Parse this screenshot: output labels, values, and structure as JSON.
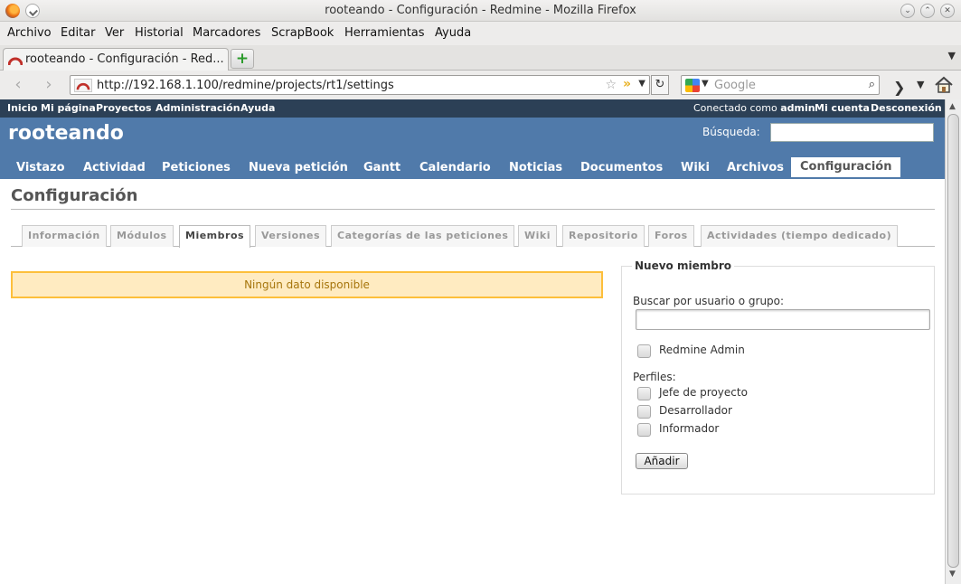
{
  "window": {
    "title": "rooteando - Configuración - Redmine - Mozilla Firefox"
  },
  "menubar": [
    "Archivo",
    "Editar",
    "Ver",
    "Historial",
    "Marcadores",
    "ScrapBook",
    "Herramientas",
    "Ayuda"
  ],
  "browser_tab": {
    "title": "rooteando - Configuración - Red..."
  },
  "navbar": {
    "url": "http://192.168.1.100/redmine/projects/rt1/settings",
    "search_placeholder": "Google"
  },
  "redmine": {
    "top_menu": [
      "Inicio",
      "Mi página",
      "Proyectos",
      "Administración",
      "Ayuda"
    ],
    "logged_as_prefix": "Conectado como",
    "logged_user": "admin",
    "account_links": [
      "Mi cuenta",
      "Desconexión"
    ],
    "project_name": "rooteando",
    "search_label": "Búsqueda:",
    "main_menu": [
      "Vistazo",
      "Actividad",
      "Peticiones",
      "Nueva petición",
      "Gantt",
      "Calendario",
      "Noticias",
      "Documentos",
      "Wiki",
      "Archivos",
      "Configuración"
    ],
    "page_title": "Configuración",
    "settings_tabs": [
      "Información",
      "Módulos",
      "Miembros",
      "Versiones",
      "Categorías de las peticiones",
      "Wiki",
      "Repositorio",
      "Foros",
      "Actividades (tiempo dedicado)"
    ],
    "selected_tab": "Miembros",
    "no_data": "Ningún dato disponible",
    "new_member": {
      "legend": "Nuevo miembro",
      "search_label": "Buscar por usuario o grupo:",
      "principals": [
        "Redmine Admin"
      ],
      "roles_label": "Perfiles:",
      "roles": [
        "Jefe de proyecto",
        "Desarrollador",
        "Informador"
      ],
      "add_button": "Añadir"
    }
  }
}
